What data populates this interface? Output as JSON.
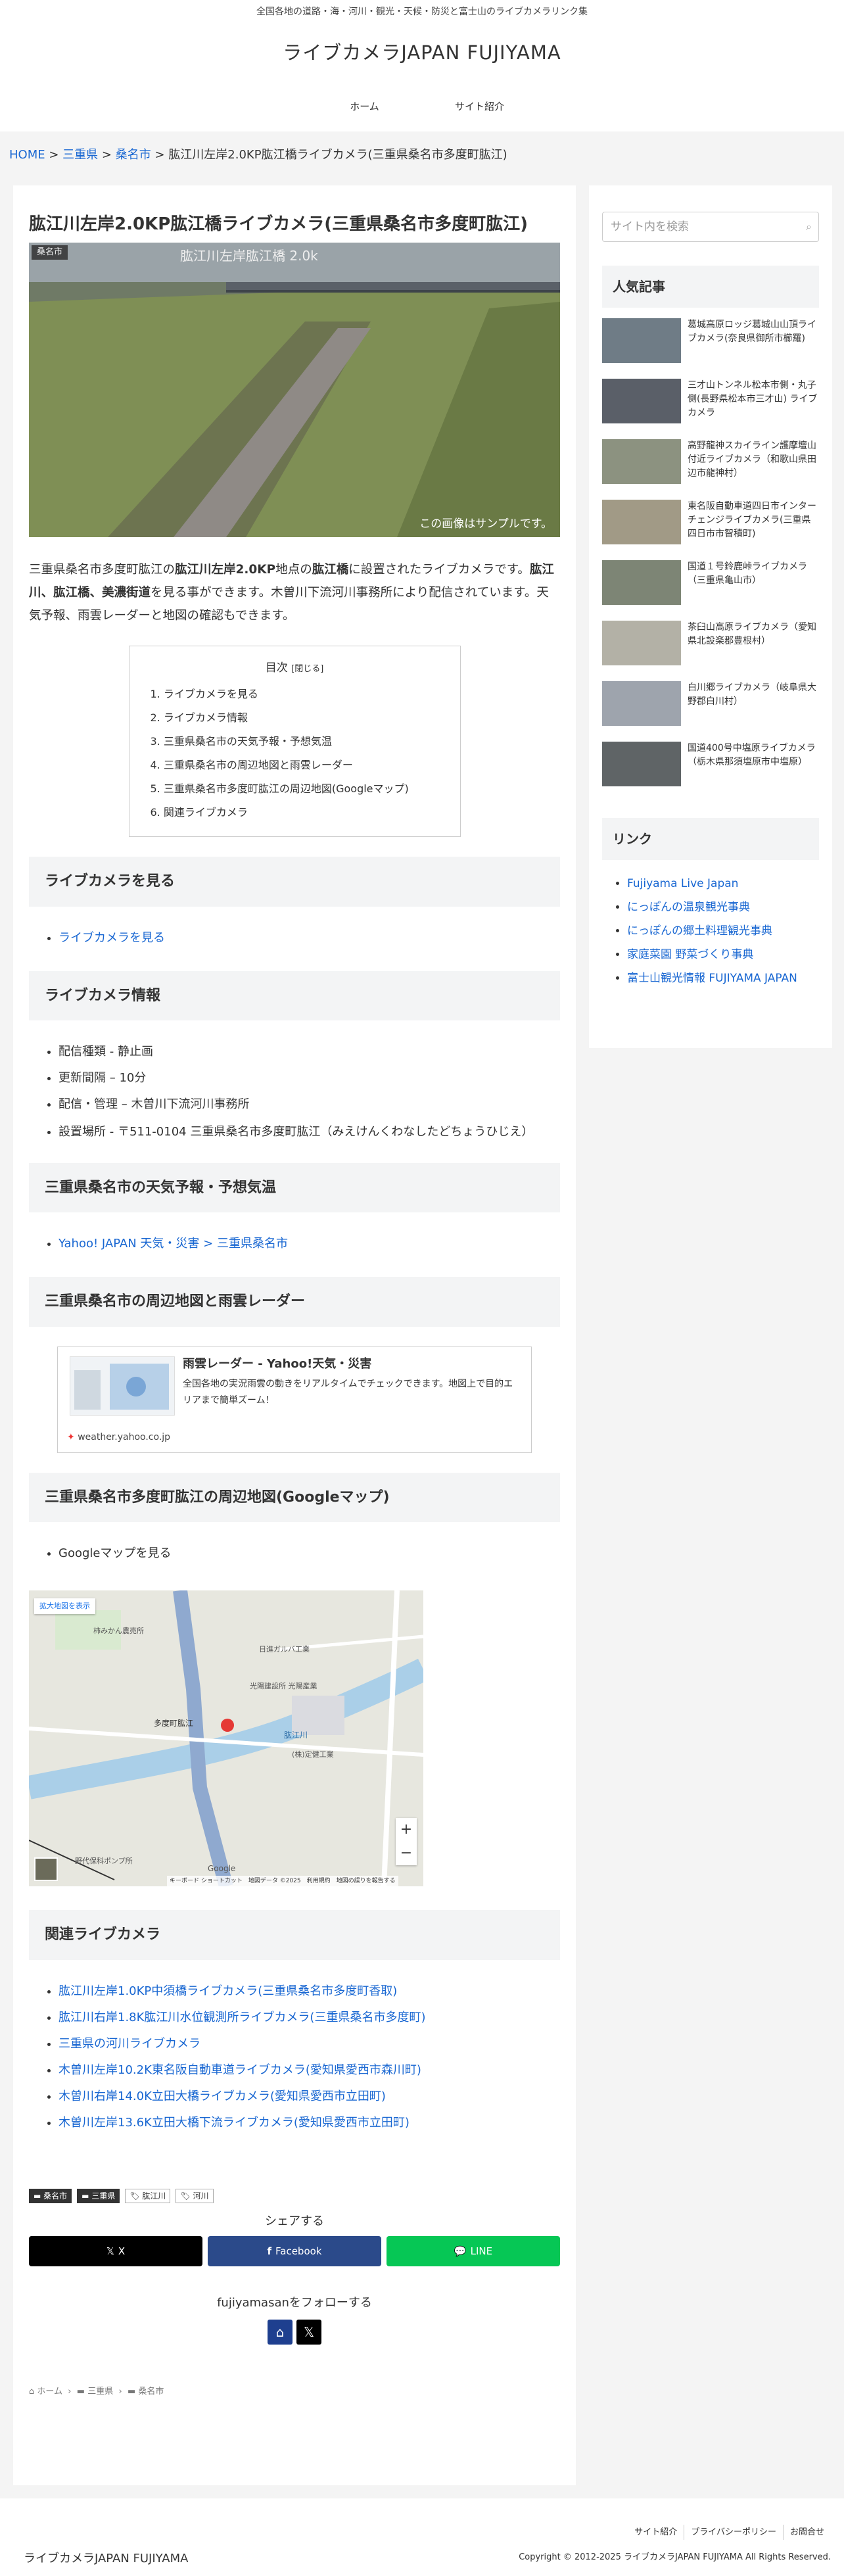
{
  "tagline": "全国各地の道路・海・河川・観光・天候・防災と富士山のライブカメラリンク集",
  "site_name": "ライブカメラJAPAN FUJIYAMA",
  "nav": [
    "ホーム",
    "サイト紹介"
  ],
  "breadcrumb": {
    "home": "HOME",
    "sep": ">",
    "pref": "三重県",
    "city": "桑名市",
    "current": "肱江川左岸2.0KP肱江橋ライブカメラ(三重県桑名市多度町肱江)"
  },
  "title": "肱江川左岸2.0KP肱江橋ライブカメラ(三重県桑名市多度町肱江)",
  "eyecatch": {
    "category": "桑名市",
    "overlay": "肱江川左岸肱江橋 2.0k",
    "sample": "この画像はサンプルです。"
  },
  "intro": {
    "p1": "三重県桑名市多度町肱江の",
    "b1": "肱江川左岸2.0KP",
    "p2": "地点の",
    "b2": "肱江橋",
    "p3": "に設置されたライブカメラです。",
    "b3": "肱江川、肱江橋、美濃街道",
    "p4": "を見る事ができます。木曽川下流河川事務所により配信されています。天気予報、雨雲レーダーと地図の確認もできます。"
  },
  "toc": {
    "title": "目次",
    "toggle": "[閉じる]",
    "items": [
      "1. ライブカメラを見る",
      "2. ライブカメラ情報",
      "3. 三重県桑名市の天気予報・予想気温",
      "4. 三重県桑名市の周辺地図と雨雲レーダー",
      "5. 三重県桑名市多度町肱江の周辺地図(Googleマップ)",
      "6. 関連ライブカメラ"
    ]
  },
  "sections": {
    "s1": "ライブカメラを見る",
    "s2": "ライブカメラ情報",
    "s3": "三重県桑名市の天気予報・予想気温",
    "s4": "三重県桑名市の周辺地図と雨雲レーダー",
    "s5": "三重県桑名市多度町肱江の周辺地図(Googleマップ)",
    "s6": "関連ライブカメラ"
  },
  "view_link": "ライブカメラを見る",
  "info": [
    "配信種類 - 静止画",
    "更新間隔 – 10分",
    "配信・管理 – 木曽川下流河川事務所",
    "設置場所 - 〒511-0104 三重県桑名市多度町肱江（みえけんくわなしたどちょうひじえ）"
  ],
  "weather_link": "Yahoo! JAPAN 天気・災害 > 三重県桑名市",
  "blogcard": {
    "title": "雨雲レーダー - Yahoo!天気・災害",
    "desc": "全国各地の実況雨雲の動きをリアルタイムでチェックできます。地図上で目的エリアまで簡単ズーム！",
    "site": "weather.yahoo.co.jp"
  },
  "gmap_label": "Googleマップを見る",
  "map": {
    "enlarge": "拡大地図を表示",
    "labels": [
      "柿みかん農売所",
      "日進ガルバ工業",
      "光陽建設所 光陽産業",
      "多度町肱江",
      "肱江川",
      "(株)定健工業",
      "野代保科ポンプ所"
    ],
    "footer": "キーボード ショートカット　地図データ ©2025　利用規約　地図の誤りを報告する",
    "google": "Google"
  },
  "related": [
    "肱江川左岸1.0KP中須橋ライブカメラ(三重県桑名市多度町香取)",
    "肱江川右岸1.8K肱江川水位観測所ライブカメラ(三重県桑名市多度町)",
    "三重県の河川ライブカメラ",
    "木曽川左岸10.2K東名阪自動車道ライブカメラ(愛知県愛西市森川町)",
    "木曽川右岸14.0K立田大橋ライブカメラ(愛知県愛西市立田町)",
    "木曽川左岸13.6K立田大橋下流ライブカメラ(愛知県愛西市立田町)"
  ],
  "tags": [
    "桑名市",
    "三重県",
    "肱江川",
    "河川"
  ],
  "share": {
    "title": "シェアする",
    "x": "X",
    "facebook": "Facebook",
    "line": "LINE"
  },
  "follow": "fujiyamasanをフォローする",
  "bottom_breadcrumb": [
    "ホーム",
    "三重県",
    "桑名市"
  ],
  "sidebar": {
    "search_placeholder": "サイト内を検索",
    "popular_title": "人気記事",
    "popular": [
      "葛城高原ロッジ葛城山山頂ライブカメラ(奈良県御所市櫛羅)",
      "三才山トンネル松本市側・丸子側(長野県松本市三才山) ライブカメラ",
      "高野龍神スカイライン護摩壇山付近ライブカメラ（和歌山県田辺市龍神村）",
      "東名阪自動車道四日市インターチェンジライブカメラ(三重県四日市市智積町)",
      "国道１号鈴鹿峠ライブカメラ（三重県亀山市）",
      "茶臼山高原ライブカメラ（愛知県北設楽郡豊根村）",
      "白川郷ライブカメラ（岐阜県大野郡白川村）",
      "国道400号中塩原ライブカメラ（栃木県那須塩原市中塩原）"
    ],
    "links_title": "リンク",
    "links": [
      "Fujiyama Live Japan",
      "にっぽんの温泉観光事典",
      "にっぽんの郷土料理観光事典",
      "家庭菜園 野菜づくり事典",
      "富士山観光情報 FUJIYAMA JAPAN"
    ]
  },
  "footer": {
    "nav": [
      "サイト紹介",
      "プライバシーポリシー",
      "お問合せ"
    ],
    "logo": "ライブカメラJAPAN FUJIYAMA",
    "copyright": "Copyright © 2012-2025 ライブカメラJAPAN FUJIYAMA All Rights Reserved."
  },
  "colors": {
    "x": "#000000",
    "facebook": "#2b4a8a",
    "line": "#06c755",
    "link": "#1967d2"
  }
}
